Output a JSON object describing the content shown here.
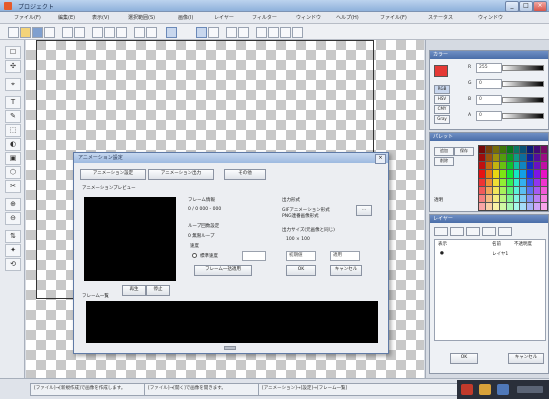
{
  "window": {
    "title": "プロジェクト",
    "controls": [
      "_",
      "□",
      "×"
    ]
  },
  "menu": [
    "ファイル(F)",
    "編集(E)",
    "表示(V)",
    "選択範囲(S)",
    "画像(I)",
    "レイヤー",
    "フィルター",
    "ウィンドウ",
    "ヘルプ(H)",
    "ファイル(F)",
    "ステータス",
    "ウィンドウ"
  ],
  "toolbar": {
    "icons": [
      "new-file-icon",
      "open-icon",
      "save-icon",
      "print-icon",
      "undo-icon",
      "redo-icon",
      "cut-icon",
      "copy-icon",
      "paste-icon",
      "zoom-in-icon",
      "zoom-out-icon",
      "grid-icon",
      "rect-select-icon",
      "lasso-icon",
      "move-icon",
      "crop-icon",
      "fill-icon",
      "text-icon",
      "layer-icon",
      "settings-icon"
    ]
  },
  "tools": [
    "☐",
    "✣",
    "⌖",
    "T",
    "✎",
    "⬚",
    "◐",
    "▣",
    "⬡",
    "✂",
    "⊕",
    "⊖",
    "⇅",
    "✦",
    "⟲"
  ],
  "colors": {
    "foreground": "#e53935",
    "accent": "#4a6ea8",
    "dialog_border": "#5f7aa6"
  },
  "color_panel": {
    "title": "カラー",
    "channels": [
      {
        "label": "R",
        "value": "255"
      },
      {
        "label": "G",
        "value": "0"
      },
      {
        "label": "B",
        "value": "0"
      },
      {
        "label": "A",
        "value": "0"
      }
    ],
    "buttons": [
      "RGB",
      "HSV",
      "CMY",
      "Gray"
    ]
  },
  "palette_panel": {
    "title": "パレット",
    "buttons": [
      "追加",
      "削除",
      "保存"
    ],
    "footer": "透明"
  },
  "layer_panel": {
    "title": "レイヤー",
    "columns": [
      "表示",
      "名前",
      "不透明度"
    ],
    "rows": [
      {
        "col1": "",
        "col2": "●",
        "col3": "レイヤ1"
      }
    ],
    "ok": "OK",
    "cancel": "キャンセル"
  },
  "dialog": {
    "title": "アニメーション設定",
    "close": "×",
    "tabs": [
      "アニメーション設定",
      "アニメーション出力",
      "その他"
    ],
    "preview_label": "アニメーションプレビュー",
    "play_button": "再生",
    "stop_button": "停止",
    "frame_label": "フレーム情報",
    "frame_value": "0 / 0   000 - 000",
    "loop_label": "ループ回数設定",
    "loop_value": "0   無限ループ",
    "speed_label": "速度",
    "speed_option": "標準速度",
    "apply_button": "フレーム一括適用",
    "output_label": "出力形式",
    "output_value1": "GIFアニメーション形式",
    "output_value2": "PNG連番画像形式",
    "output_browse": "...",
    "size_label": "出力サイズ(元画像と同じ)",
    "size_value": "100 × 100",
    "ok_button": "OK",
    "cancel_button": "キャンセル",
    "default_button": "初期値",
    "apply_small": "適用",
    "timeline_label": "フレーム一覧"
  },
  "status": [
    "[ファイル]→[新規作成]で画像を作成します。",
    "[ファイル]→[開く]で画像を開きます。",
    "[アニメーション]→[設定]→[フレーム一覧]"
  ]
}
